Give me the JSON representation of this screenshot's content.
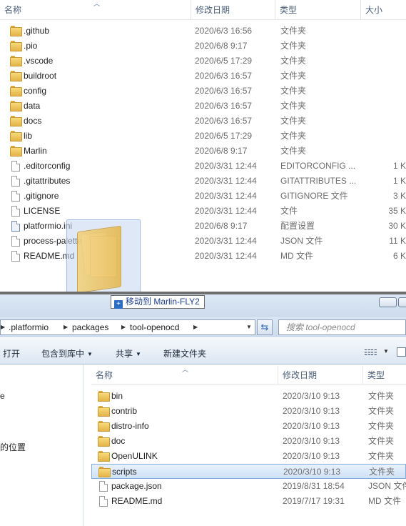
{
  "top_window": {
    "columns": {
      "name": "名称",
      "modified": "修改日期",
      "type": "类型",
      "size": "大小"
    },
    "rows": [
      {
        "icon": "folder-icon",
        "name": ".github",
        "date": "2020/6/3 16:56",
        "type": "文件夹",
        "size": ""
      },
      {
        "icon": "folder-icon",
        "name": ".pio",
        "date": "2020/6/8 9:17",
        "type": "文件夹",
        "size": ""
      },
      {
        "icon": "folder-icon",
        "name": ".vscode",
        "date": "2020/6/5 17:29",
        "type": "文件夹",
        "size": ""
      },
      {
        "icon": "folder-icon",
        "name": "buildroot",
        "date": "2020/6/3 16:57",
        "type": "文件夹",
        "size": ""
      },
      {
        "icon": "folder-icon",
        "name": "config",
        "date": "2020/6/3 16:57",
        "type": "文件夹",
        "size": ""
      },
      {
        "icon": "folder-icon",
        "name": "data",
        "date": "2020/6/3 16:57",
        "type": "文件夹",
        "size": ""
      },
      {
        "icon": "folder-icon",
        "name": "docs",
        "date": "2020/6/3 16:57",
        "type": "文件夹",
        "size": ""
      },
      {
        "icon": "folder-icon",
        "name": "lib",
        "date": "2020/6/5 17:29",
        "type": "文件夹",
        "size": ""
      },
      {
        "icon": "folder-icon",
        "name": "Marlin",
        "date": "2020/6/8 9:17",
        "type": "文件夹",
        "size": ""
      },
      {
        "icon": "file-icon",
        "name": ".editorconfig",
        "date": "2020/3/31 12:44",
        "type": "EDITORCONFIG ...",
        "size": "1 K"
      },
      {
        "icon": "file-icon",
        "name": ".gitattributes",
        "date": "2020/3/31 12:44",
        "type": "GITATTRIBUTES ...",
        "size": "1 K"
      },
      {
        "icon": "file-icon",
        "name": ".gitignore",
        "date": "2020/3/31 12:44",
        "type": "GITIGNORE 文件",
        "size": "3 K"
      },
      {
        "icon": "file-icon",
        "name": "LICENSE",
        "date": "2020/3/31 12:44",
        "type": "文件",
        "size": "35 K"
      },
      {
        "icon": "config-file-icon",
        "name": "platformio.ini",
        "date": "2020/6/8 9:17",
        "type": "配置设置",
        "size": "30 K"
      },
      {
        "icon": "file-icon",
        "name": "process-palette.json",
        "date": "2020/3/31 12:44",
        "type": "JSON 文件",
        "size": "11 K"
      },
      {
        "icon": "file-icon",
        "name": "README.md",
        "date": "2020/3/31 12:44",
        "type": "MD 文件",
        "size": "6 K"
      }
    ]
  },
  "drag_tooltip": {
    "text": "移动到 Marlin-FLY2"
  },
  "bottom_window": {
    "breadcrumb": [
      ".platformio",
      "packages",
      "tool-openocd"
    ],
    "search_placeholder": "搜索 tool-openocd",
    "toolbar": {
      "open": "打开",
      "include_in_library": "包含到库中",
      "share": "共享",
      "new_folder": "新建文件夹"
    },
    "nav_items": [
      "e",
      "的位置"
    ],
    "columns": {
      "name": "名称",
      "modified": "修改日期",
      "type": "类型"
    },
    "rows": [
      {
        "icon": "folder-icon",
        "name": "bin",
        "date": "2020/3/10 9:13",
        "type": "文件夹",
        "selected": false
      },
      {
        "icon": "folder-icon",
        "name": "contrib",
        "date": "2020/3/10 9:13",
        "type": "文件夹",
        "selected": false
      },
      {
        "icon": "folder-icon",
        "name": "distro-info",
        "date": "2020/3/10 9:13",
        "type": "文件夹",
        "selected": false
      },
      {
        "icon": "folder-icon",
        "name": "doc",
        "date": "2020/3/10 9:13",
        "type": "文件夹",
        "selected": false
      },
      {
        "icon": "folder-icon",
        "name": "OpenULINK",
        "date": "2020/3/10 9:13",
        "type": "文件夹",
        "selected": false
      },
      {
        "icon": "folder-icon",
        "name": "scripts",
        "date": "2020/3/10 9:13",
        "type": "文件夹",
        "selected": true
      },
      {
        "icon": "file-icon",
        "name": "package.json",
        "date": "2019/8/31 18:54",
        "type": "JSON 文件",
        "selected": false
      },
      {
        "icon": "file-icon",
        "name": "README.md",
        "date": "2019/7/17 19:31",
        "type": "MD 文件",
        "selected": false
      }
    ]
  }
}
